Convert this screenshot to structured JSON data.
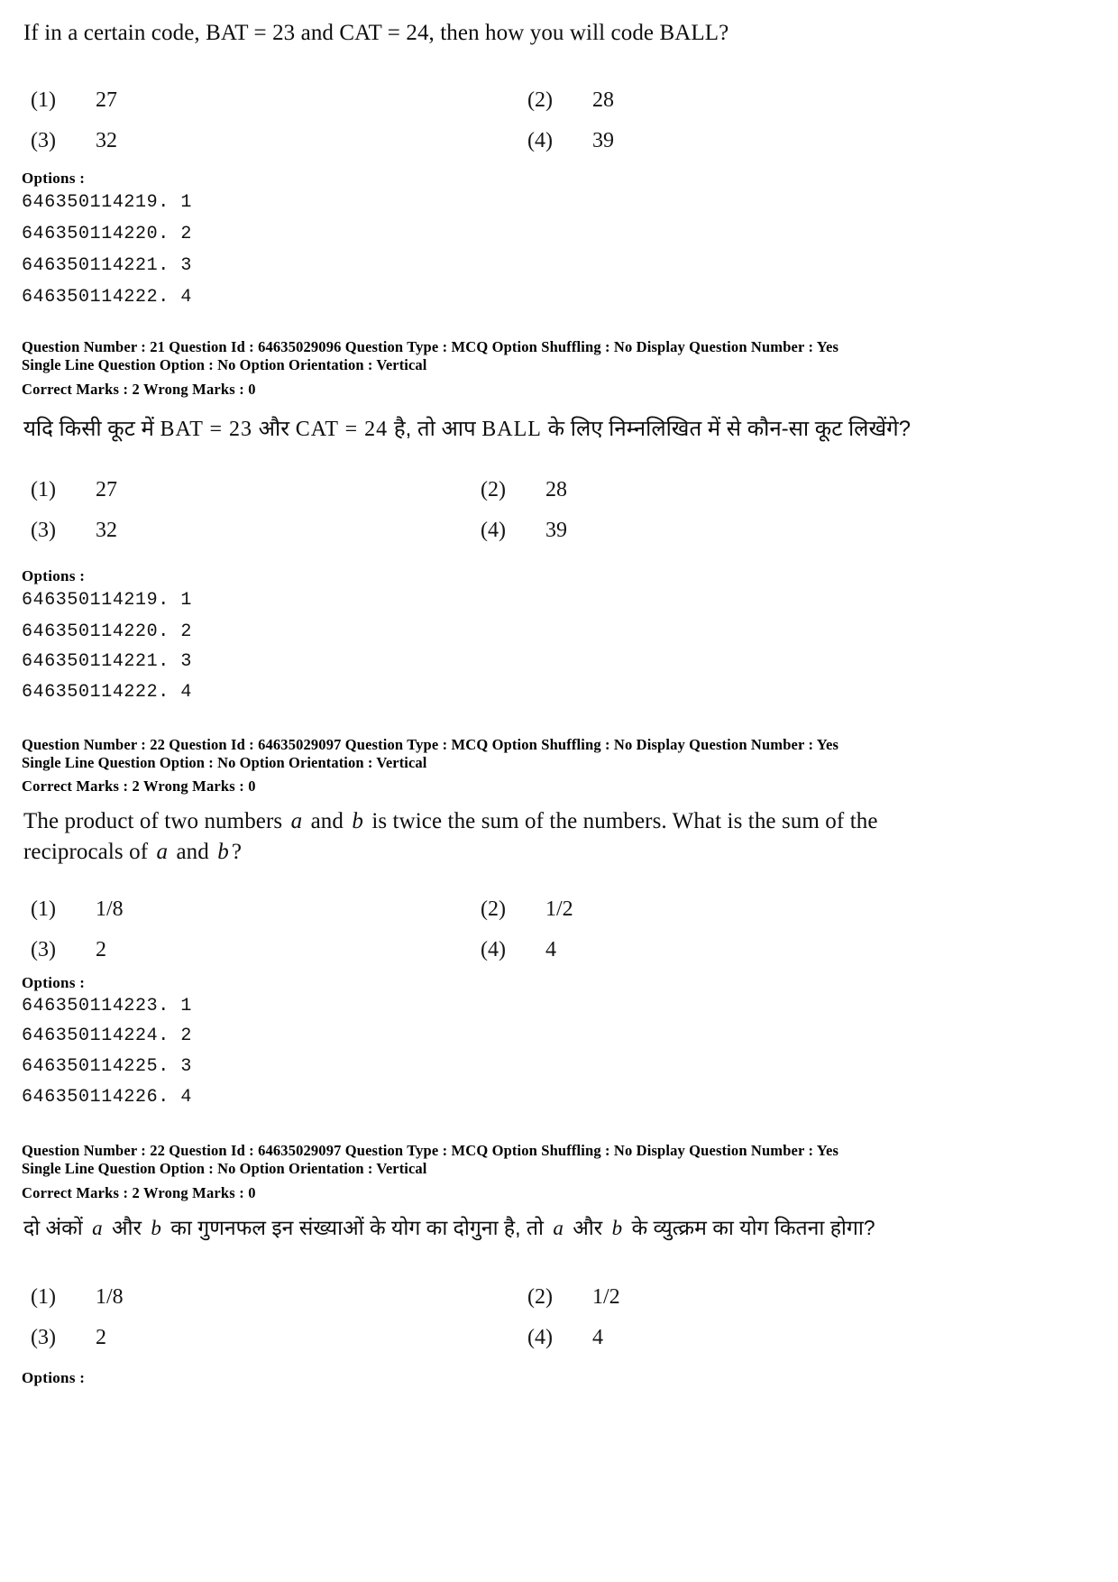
{
  "document": {
    "type": "exam-question-paper",
    "language_pairs": [
      "English",
      "Hindi"
    ]
  },
  "blocks": {
    "q21_en": {
      "stem_prefix": "If in a certain code, BAT = 23 and CAT = 24, then how you will code BALL?",
      "choices": [
        {
          "num": "(1)",
          "text": "27"
        },
        {
          "num": "(2)",
          "text": "28"
        },
        {
          "num": "(3)",
          "text": "32"
        },
        {
          "num": "(4)",
          "text": "39"
        }
      ],
      "options_label": "Options :",
      "option_ids": [
        "646350114219. 1",
        "646350114220. 2",
        "646350114221. 3",
        "646350114222. 4"
      ]
    },
    "q21_meta": {
      "line1": "Question Number : 21  Question Id : 64635029096  Question Type : MCQ  Option Shuffling : No  Display Question Number : Yes",
      "line2": "Single Line Question Option : No  Option Orientation : Vertical",
      "line3": "Correct Marks : 2  Wrong Marks : 0"
    },
    "q21_hi": {
      "stem_p1": "यदि किसी कूट में ",
      "stem_lat1": "BAT = 23",
      "stem_p2": " और ",
      "stem_lat2": "CAT = 24",
      "stem_p3": " है, तो आप ",
      "stem_lat3": "BALL",
      "stem_p4": " के लिए निम्नलिखित में से कौन-सा कूट लिखेंगे?",
      "choices": [
        {
          "num": "(1)",
          "text": "27"
        },
        {
          "num": "(2)",
          "text": "28"
        },
        {
          "num": "(3)",
          "text": "32"
        },
        {
          "num": "(4)",
          "text": "39"
        }
      ],
      "options_label": "Options :",
      "option_ids": [
        "646350114219. 1",
        "646350114220. 2",
        "646350114221. 3",
        "646350114222. 4"
      ]
    },
    "q22_meta_en": {
      "line1": "Question Number : 22  Question Id : 64635029097  Question Type : MCQ  Option Shuffling : No  Display Question Number : Yes",
      "line2": "Single Line Question Option : No  Option Orientation : Vertical",
      "line3": "Correct Marks : 2  Wrong Marks : 0"
    },
    "q22_en": {
      "stem_s1": "The product of two numbers",
      "stem_v1": "a",
      "stem_s2": "and",
      "stem_v2": "b",
      "stem_s3": "is twice the sum of the numbers. What is the sum of",
      "stem_s4": "the reciprocals of",
      "stem_v3": "a",
      "stem_s5": "and",
      "stem_v4": "b",
      "stem_s6": "?",
      "choices": [
        {
          "num": "(1)",
          "text": "1/8"
        },
        {
          "num": "(2)",
          "text": "1/2"
        },
        {
          "num": "(3)",
          "text": "2"
        },
        {
          "num": "(4)",
          "text": "4"
        }
      ],
      "options_label": "Options :",
      "option_ids": [
        "646350114223. 1",
        "646350114224. 2",
        "646350114225. 3",
        "646350114226. 4"
      ]
    },
    "q22_meta_hi": {
      "line1": "Question Number : 22  Question Id : 64635029097  Question Type : MCQ  Option Shuffling : No  Display Question Number : Yes",
      "line2": "Single Line Question Option : No  Option Orientation : Vertical",
      "line3": "Correct Marks : 2  Wrong Marks : 0"
    },
    "q22_hi": {
      "stem_p1": "दो अंकों ",
      "stem_v1": "a",
      "stem_p2": " और ",
      "stem_v2": "b",
      "stem_p3": " का गुणनफल इन संख्याओं के योग का दोगुना है, तो ",
      "stem_v3": "a",
      "stem_p4": " और ",
      "stem_v4": "b",
      "stem_p5": " के व्युत्क्रम का योग कितना होगा?",
      "choices": [
        {
          "num": "(1)",
          "text": "1/8"
        },
        {
          "num": "(2)",
          "text": "1/2"
        },
        {
          "num": "(3)",
          "text": "2"
        },
        {
          "num": "(4)",
          "text": "4"
        }
      ],
      "options_label": "Options :"
    }
  }
}
